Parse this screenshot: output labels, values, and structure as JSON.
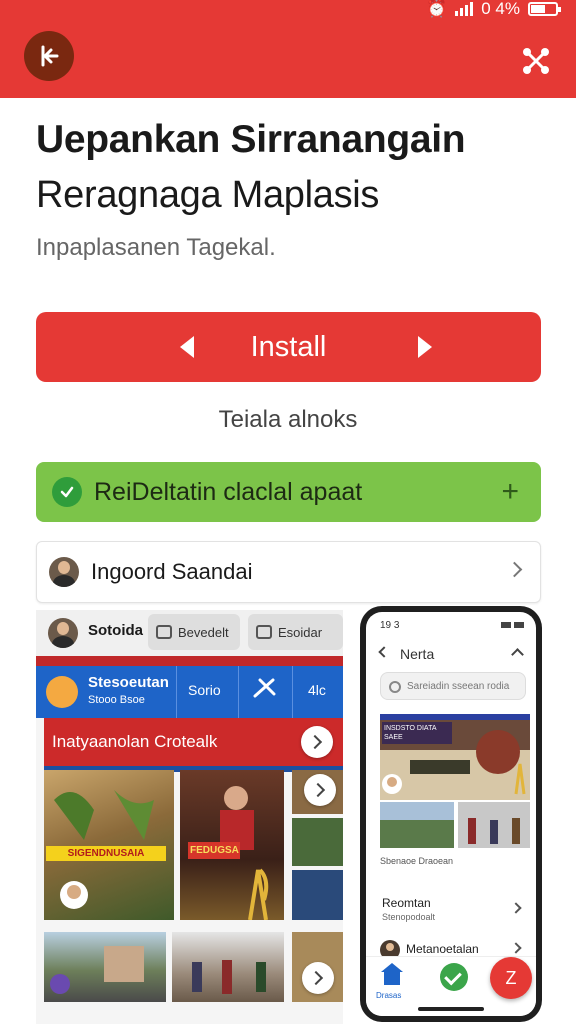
{
  "status_bar": {
    "battery_text": "0 4%"
  },
  "header": {
    "back_icon": "back-arrow-icon",
    "share_icon": "share-icon",
    "color": "#e53935"
  },
  "app": {
    "title_line1": "Uepankan Sirranangain",
    "title_line2": "Reragnaga Maplasis",
    "subtitle": "Inpaplasanen Tagekal."
  },
  "install_button": {
    "label": "Install",
    "color": "#e53935"
  },
  "secondary_text": "Teiala alnoks",
  "green_bar": {
    "label": "ReiDeltatin claclal apaat",
    "plus": "+",
    "color": "#7cc449"
  },
  "developer": {
    "name": "Ingoord Saandai"
  },
  "screenshot1": {
    "header_title": "Sotoida",
    "pill1": "Bevedelt",
    "pill2": "Esoidar",
    "nav_title": "Stesoeutan",
    "nav_sub": "Stooo Bsoe",
    "tab1": "Sorio",
    "tab2": "4lc",
    "banner": "Inatyaanolan Crotealk",
    "poster1_text": "SIGENDNUSAIA",
    "poster2_text": "FEDUGSA"
  },
  "phone": {
    "time": "19 3",
    "screen_title": "Nerta",
    "search_placeholder": "Sareiadin sseean rodia",
    "hero_text": "INSDSTO DIATA SAEE",
    "caption": "Sbenaoe Draoean",
    "item1_title": "Reomtan",
    "item1_sub": "Stenopodoalt",
    "item2_title": "Metanoetalan",
    "home_label": "Drasas",
    "fab_label": "Z"
  }
}
